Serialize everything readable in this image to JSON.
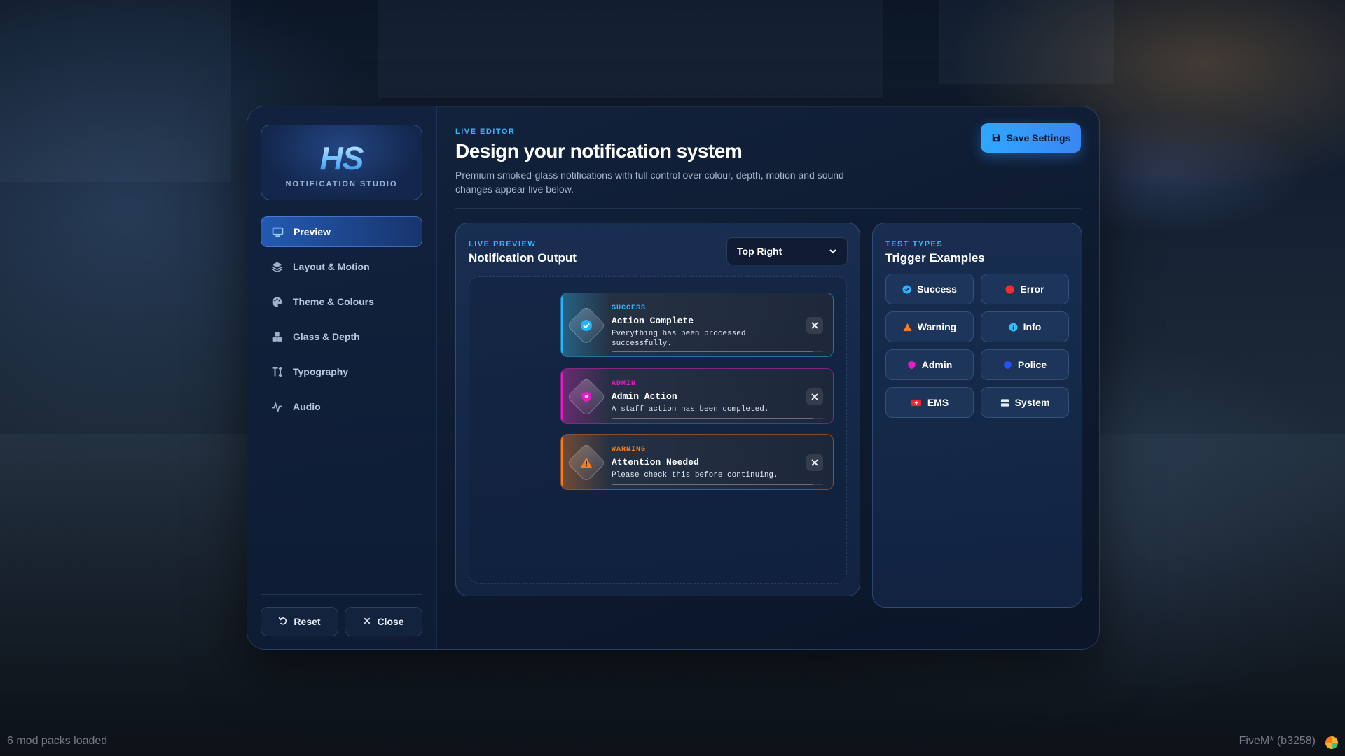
{
  "sidebar": {
    "logo_mark": "HS",
    "logo_sub": "NOTIFICATION STUDIO",
    "items": [
      {
        "label": "Preview",
        "icon": "monitor-icon",
        "active": true
      },
      {
        "label": "Layout & Motion",
        "icon": "layers-icon",
        "active": false
      },
      {
        "label": "Theme & Colours",
        "icon": "palette-icon",
        "active": false
      },
      {
        "label": "Glass & Depth",
        "icon": "cubes-icon",
        "active": false
      },
      {
        "label": "Typography",
        "icon": "text-height-icon",
        "active": false
      },
      {
        "label": "Audio",
        "icon": "waveform-icon",
        "active": false
      }
    ],
    "reset_label": "Reset",
    "close_label": "Close"
  },
  "header": {
    "eyebrow": "LIVE EDITOR",
    "title": "Design your notification system",
    "description": "Premium smoked-glass notifications with full control over colour, depth, motion and sound — changes appear live below.",
    "save_label": "Save Settings"
  },
  "preview": {
    "eyebrow": "LIVE PREVIEW",
    "title": "Notification Output",
    "position_value": "Top Right",
    "notifications": [
      {
        "type": "SUCCESS",
        "title": "Action Complete",
        "message": "Everything has been processed successfully.",
        "color": "#22b8ff",
        "icon": "check-circle-icon",
        "progress": 0.95
      },
      {
        "type": "ADMIN",
        "title": "Admin Action",
        "message": "A staff action has been completed.",
        "color": "#e81cc7",
        "icon": "shield-icon",
        "progress": 0.95
      },
      {
        "type": "WARNING",
        "title": "Attention Needed",
        "message": "Please check this before continuing.",
        "color": "#ff7a1a",
        "icon": "warning-triangle-icon",
        "progress": 0.95
      }
    ]
  },
  "tests": {
    "eyebrow": "TEST TYPES",
    "title": "Trigger Examples",
    "buttons": [
      {
        "label": "Success",
        "color": "#2cb4ff",
        "icon": "check-circle-icon"
      },
      {
        "label": "Error",
        "color": "#ff2a2a",
        "icon": "error-circle-icon"
      },
      {
        "label": "Warning",
        "color": "#ff7a1a",
        "icon": "warning-triangle-icon"
      },
      {
        "label": "Info",
        "color": "#2cc0ff",
        "icon": "info-circle-icon"
      },
      {
        "label": "Admin",
        "color": "#e81cc7",
        "icon": "shield-icon"
      },
      {
        "label": "Police",
        "color": "#2452ff",
        "icon": "police-badge-icon"
      },
      {
        "label": "EMS",
        "color": "#ff2030",
        "icon": "ambulance-icon"
      },
      {
        "label": "System",
        "color": "#e8eef9",
        "icon": "server-icon"
      }
    ]
  },
  "overlay": {
    "bottom_left": "6 mod packs loaded",
    "bottom_right": "FiveM* (b3258)"
  }
}
